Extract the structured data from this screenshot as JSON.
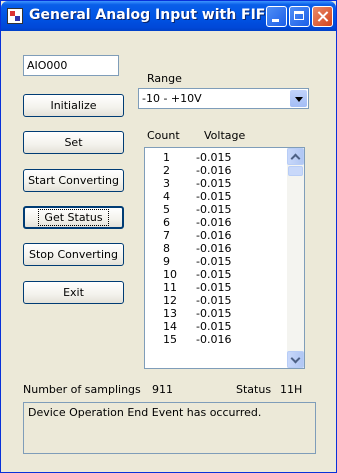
{
  "window": {
    "title": "General Analog Input with FIFO"
  },
  "device": {
    "name_value": "AIO000"
  },
  "buttons": {
    "initialize": "Initialize",
    "set": "Set",
    "start_converting": "Start Converting",
    "get_status": "Get Status",
    "stop_converting": "Stop Converting",
    "exit": "Exit"
  },
  "range": {
    "label": "Range",
    "selected": "-10 - +10V"
  },
  "list": {
    "headers": [
      "Count",
      "Voltage"
    ],
    "rows": [
      [
        "1",
        "-0.015"
      ],
      [
        "2",
        "-0.016"
      ],
      [
        "3",
        "-0.015"
      ],
      [
        "4",
        "-0.015"
      ],
      [
        "5",
        "-0.015"
      ],
      [
        "6",
        "-0.016"
      ],
      [
        "7",
        "-0.016"
      ],
      [
        "8",
        "-0.016"
      ],
      [
        "9",
        "-0.015"
      ],
      [
        "10",
        "-0.015"
      ],
      [
        "11",
        "-0.015"
      ],
      [
        "12",
        "-0.015"
      ],
      [
        "13",
        "-0.015"
      ],
      [
        "14",
        "-0.015"
      ],
      [
        "15",
        "-0.016"
      ]
    ]
  },
  "footer": {
    "samplings_label": "Number of samplings",
    "samplings_value": "911",
    "status_label": "Status",
    "status_value": "11H",
    "message": "Device Operation End Event has occurred."
  }
}
